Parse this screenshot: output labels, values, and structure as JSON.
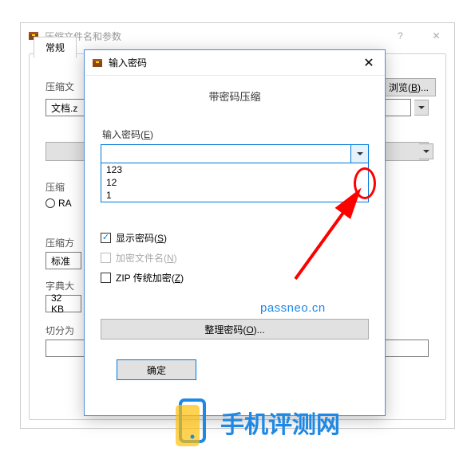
{
  "main_window": {
    "title": "压缩文件名和参数",
    "tab_general": "常规",
    "archive_name_label": "压缩文",
    "archive_name_value": "文档.z",
    "browse_btn": "浏览(B)...",
    "format_label": "压缩",
    "format_rar": "RA",
    "method_label": "压缩方",
    "method_value": "标准",
    "dict_label": "字典大",
    "dict_value": "32 KB",
    "split_label": "切分为"
  },
  "pwd_dialog": {
    "title": "输入密码",
    "header": "带密码压缩",
    "input_label": "输入密码(E)",
    "input_value": "",
    "dropdown_items": [
      "123",
      "12",
      "1"
    ],
    "show_pwd": "显示密码(S)",
    "encrypt_names": "加密文件名(N)",
    "zip_legacy": "ZIP 传统加密(Z)",
    "organize_btn": "整理密码(O)...",
    "ok_btn": "确定"
  },
  "annotations": {
    "watermark": "passneo.cn",
    "brand": "手机评测网"
  }
}
